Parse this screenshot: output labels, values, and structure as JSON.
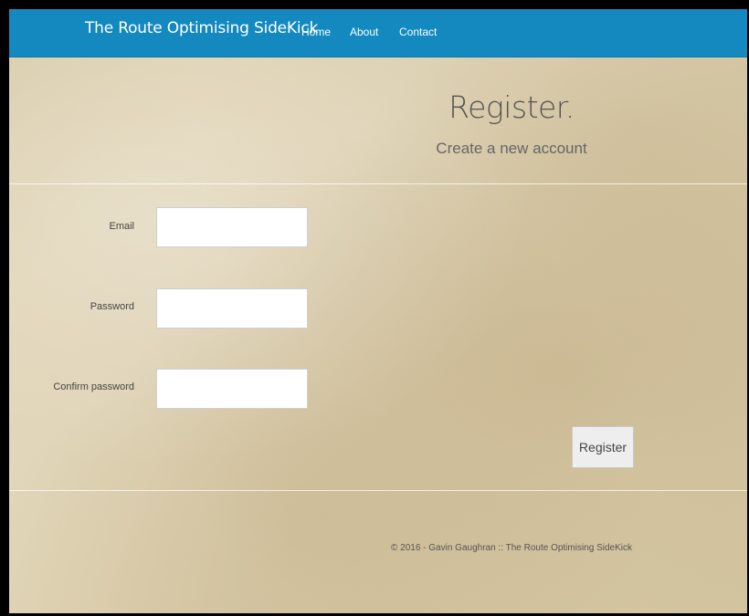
{
  "navbar": {
    "brand": "The Route Optimising SideKick",
    "links": [
      {
        "label": "Home"
      },
      {
        "label": "About"
      },
      {
        "label": "Contact"
      }
    ]
  },
  "page": {
    "title": "Register.",
    "subtitle": "Create a new account"
  },
  "form": {
    "email_label": "Email",
    "email_value": "",
    "password_label": "Password",
    "password_value": "",
    "confirm_label": "Confirm password",
    "confirm_value": "",
    "submit_label": "Register"
  },
  "footer": {
    "text": "© 2016 - Gavin Gaughran :: The Route Optimising SideKick"
  },
  "colors": {
    "navbar": "#1389bf",
    "background": "#dccfae"
  }
}
